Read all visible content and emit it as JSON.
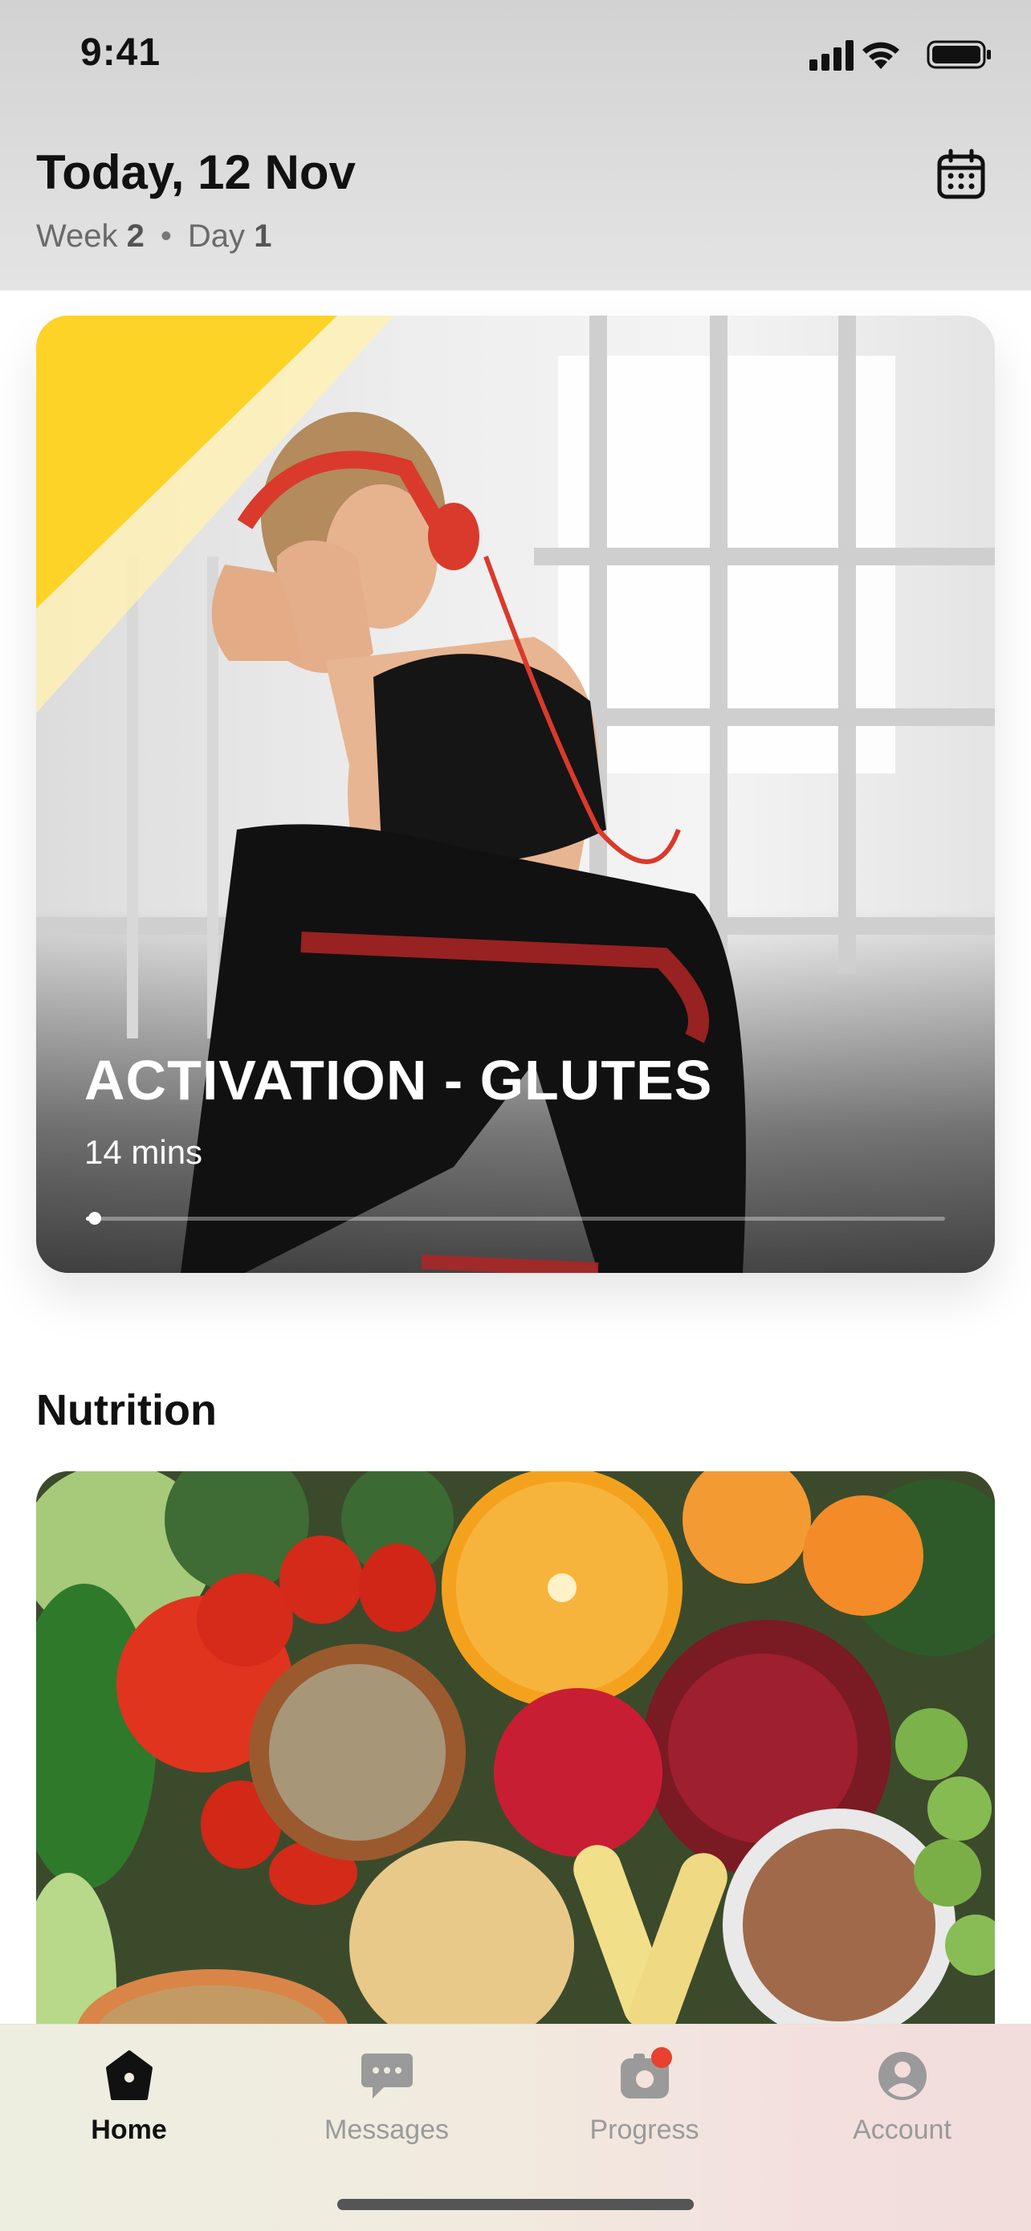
{
  "status_bar": {
    "time": "9:41"
  },
  "header": {
    "date_title": "Today, 12 Nov",
    "week_label": "Week",
    "week_number": "2",
    "day_label": "Day",
    "day_number": "1",
    "separator": "•"
  },
  "workout": {
    "title": "ACTIVATION - GLUTES",
    "duration": "14 mins",
    "progress": 0.01,
    "accent_color": "#FDD327"
  },
  "nutrition": {
    "section_title": "Nutrition"
  },
  "tabbar": {
    "tabs": [
      {
        "label": "Home",
        "icon": "home-icon",
        "active": true
      },
      {
        "label": "Messages",
        "icon": "messages-icon",
        "active": false
      },
      {
        "label": "Progress",
        "icon": "progress-camera-icon",
        "active": false,
        "badge": true
      },
      {
        "label": "Account",
        "icon": "account-icon",
        "active": false
      }
    ]
  },
  "colors": {
    "notification_badge": "#E8412F",
    "inactive_tab": "#9A9A9A",
    "active_tab": "#111111"
  }
}
